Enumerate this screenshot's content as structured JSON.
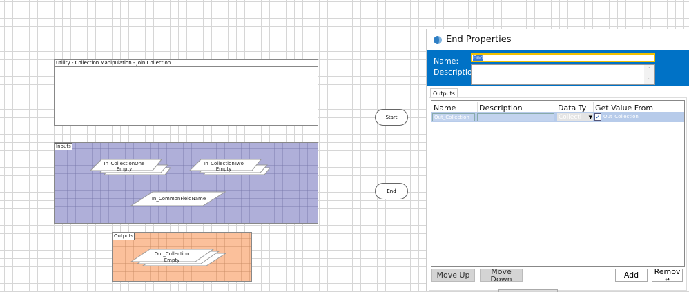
{
  "canvas": {
    "title_box": {
      "label": "Utility - Collection Manipulation - Join Collection"
    },
    "inputs": {
      "label": "Inputs",
      "items": [
        {
          "name": "In_CollectionOne",
          "sub": "Empty"
        },
        {
          "name": "In_CollectionTwo",
          "sub": "Empty"
        },
        {
          "name": "In_CommonFieldName"
        }
      ]
    },
    "outputs": {
      "label": "Outputs",
      "items": [
        {
          "name": "Out_Collection",
          "sub": "Empty"
        }
      ]
    },
    "start_label": "Start",
    "end_label": "End",
    "colors": {
      "inputs": "#afafd9",
      "outputs": "#fbc09b"
    }
  },
  "dialog": {
    "title": "End Properties",
    "icon": "stage-icon",
    "name_label": "Name:",
    "name_value": "End",
    "description_label": "Description:",
    "description_value": "",
    "tab": "Outputs",
    "columns": [
      "Name",
      "Description",
      "Data Ty",
      "Get Value From"
    ],
    "rows": [
      {
        "name": "Out_Collection",
        "description": "",
        "data_type": "Collecti",
        "get_value_from": "Out_Collection"
      }
    ],
    "buttons": {
      "move_up": "Move Up",
      "move_down": "Move Down",
      "add": "Add",
      "remove": "Remove"
    },
    "accent": "#0072c6"
  }
}
